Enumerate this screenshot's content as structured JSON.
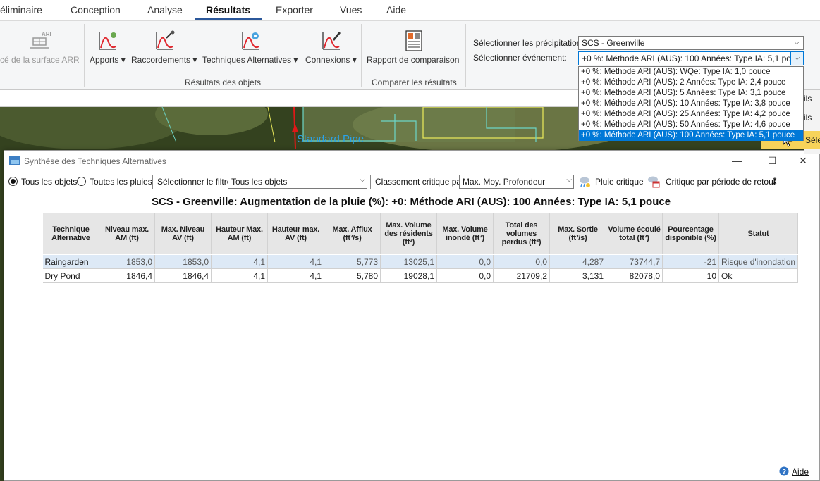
{
  "ribbon": {
    "tabs": [
      {
        "label": "éliminaire"
      },
      {
        "label": "Conception"
      },
      {
        "label": "Analyse"
      },
      {
        "label": "Résultats",
        "active": true
      },
      {
        "label": "Exporter"
      },
      {
        "label": "Vues"
      },
      {
        "label": "Aide"
      }
    ],
    "buttons": {
      "surface_arr": "cé de la surface ARR",
      "arr_icon_text": "ARR",
      "apports": "Apports",
      "raccordements": "Raccordements",
      "techniques": "Techniques Alternatives",
      "connexions": "Connexions",
      "rapport": "Rapport de comparaison"
    },
    "groups": {
      "resultats_objets": "Résultats des objets",
      "comparer": "Comparer les résultats"
    },
    "precip_label": "Sélectionner les précipitations:",
    "precip_value": "SCS - Greenville",
    "event_label": "Sélectionner événement:",
    "event_value": "+0 %: Méthode ARI (AUS): 100 Années: Type IA: 5,1 pouce",
    "event_options": [
      {
        "label": "+0 %: Méthode ARI (AUS): WQe: Type IA: 1,0 pouce"
      },
      {
        "label": "+0 %: Méthode ARI (AUS): 2 Années: Type IA: 2,4 pouce"
      },
      {
        "label": "+0 %: Méthode ARI (AUS): 5 Années: Type IA: 3,1 pouce"
      },
      {
        "label": "+0 %: Méthode ARI (AUS): 10 Années: Type IA: 3,8 pouce"
      },
      {
        "label": "+0 %: Méthode ARI (AUS): 25 Années: Type IA: 4,2 pouce"
      },
      {
        "label": "+0 %: Méthode ARI (AUS): 50 Années: Type IA: 4,6 pouce"
      },
      {
        "label": "+0 %: Méthode ARI (AUS): 100 Années: Type IA: 5,1 pouce",
        "selected": true
      }
    ]
  },
  "map": {
    "pipe_label": "Standard Pipe"
  },
  "right_panel": {
    "text_a": "ils",
    "text_b": "ils",
    "text_c": "Sélec"
  },
  "dialog": {
    "title": "Synthèse des Techniques Alternatives",
    "radio_all_objects": "Tous les objets",
    "radio_all_rains": "Toutes les pluies",
    "filter_label": "Sélectionner le filtre",
    "filter_value": "Tous les objets",
    "critical_label": "Classement critique par:",
    "critical_value": "Max. Moy. Profondeur",
    "critical_rain": "Pluie critique",
    "critical_return": "Critique par période de retour",
    "report_title": "SCS - Greenville: Augmentation de la pluie (%): +0: Méthode ARI (AUS): 100 Années: Type IA: 5,1 pouce",
    "columns": [
      "Technique Alternative",
      "Niveau max. AM (ft)",
      "Max. Niveau AV (ft)",
      "Hauteur Max. AM (ft)",
      "Hauteur max. AV (ft)",
      "Max. Afflux (ft³/s)",
      "Max. Volume des résidents (ft³)",
      "Max. Volume inondé (ft³)",
      "Total des volumes perdus (ft³)",
      "Max. Sortie (ft³/s)",
      "Volume écoulé total (ft³)",
      "Pourcentage disponible (%)",
      "Statut"
    ],
    "rows": [
      [
        "Raingarden",
        "1853,0",
        "1853,0",
        "4,1",
        "4,1",
        "5,773",
        "13025,1",
        "0,0",
        "0,0",
        "4,287",
        "73744,7",
        "-21",
        "Risque d'inondation"
      ],
      [
        "Dry Pond",
        "1846,4",
        "1846,4",
        "4,1",
        "4,1",
        "5,780",
        "19028,1",
        "0,0",
        "21709,2",
        "3,131",
        "82078,0",
        "10",
        "Ok"
      ]
    ],
    "help": "Aide"
  }
}
